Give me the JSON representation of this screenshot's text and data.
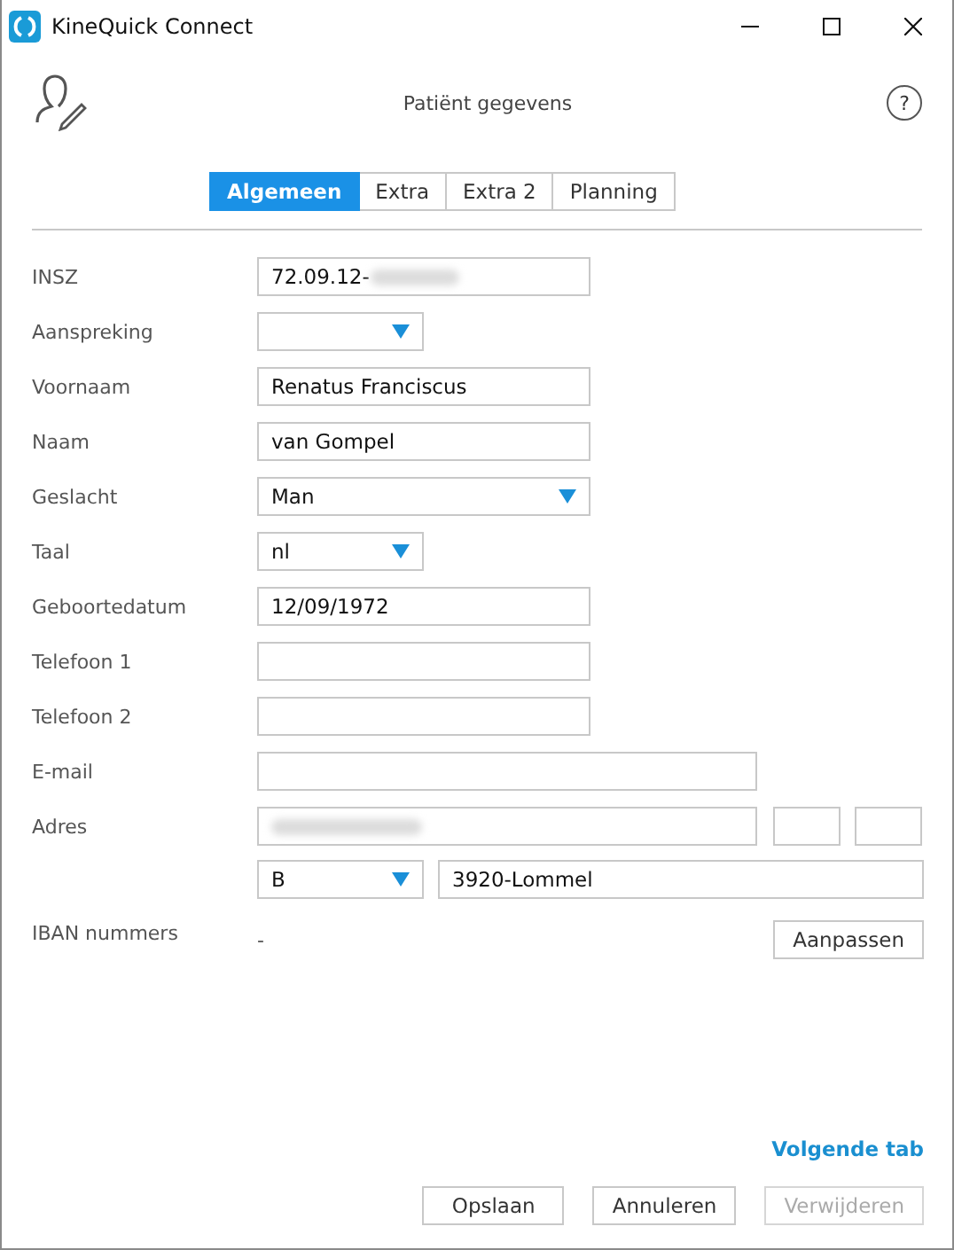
{
  "window": {
    "title": "KineQuick Connect"
  },
  "header": {
    "title": "Patiënt gegevens",
    "help": "?"
  },
  "tabs": [
    {
      "label": "Algemeen",
      "selected": true
    },
    {
      "label": "Extra",
      "selected": false
    },
    {
      "label": "Extra 2",
      "selected": false
    },
    {
      "label": "Planning",
      "selected": false
    }
  ],
  "fields": [
    {
      "kind": "text",
      "label": "INSZ",
      "value": "72.09.12-",
      "redacted": true
    },
    {
      "kind": "select",
      "label": "Aanspreking"
    },
    {
      "kind": "text",
      "label": "Voornaam",
      "value": "Renatus Franciscus"
    },
    {
      "kind": "text",
      "label": "Naam",
      "value": "van Gompel"
    },
    {
      "kind": "select",
      "label": "Geslacht",
      "value": "Man"
    },
    {
      "kind": "select",
      "label": "Taal",
      "value": "nl"
    },
    {
      "kind": "text",
      "label": "Geboortedatum",
      "value": "12/09/1972"
    },
    {
      "kind": "text",
      "label": "Telefoon 1"
    },
    {
      "kind": "text",
      "label": "Telefoon 2"
    },
    {
      "kind": "text",
      "label": "E-mail"
    },
    {
      "kind": "address",
      "label": "Adres",
      "redacted": true,
      "country": "B",
      "city": "3920-Lommel"
    },
    {
      "kind": "iban",
      "label": "IBAN nummers",
      "value": "-",
      "button": "Aanpassen"
    }
  ],
  "next_link": "Volgende tab",
  "buttons": [
    {
      "label": "Opslaan",
      "disabled": false
    },
    {
      "label": "Annuleren",
      "disabled": false
    },
    {
      "label": "Verwijderen",
      "disabled": true
    }
  ]
}
